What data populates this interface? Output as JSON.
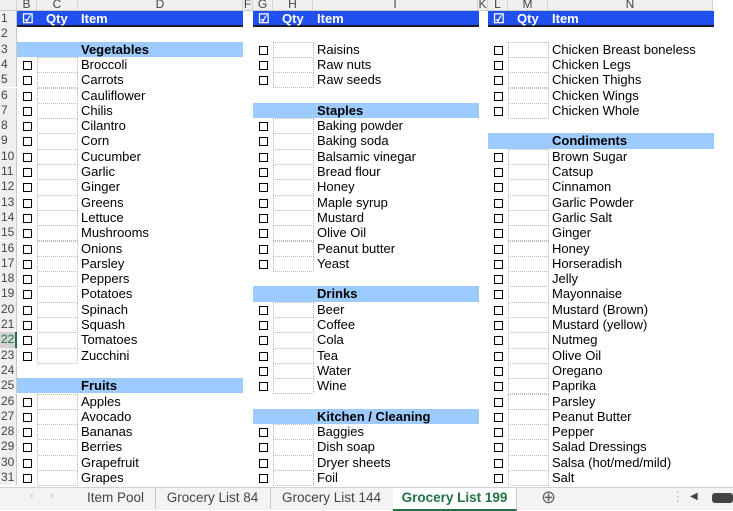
{
  "column_headers": [
    {
      "label": "B",
      "l": 17,
      "w": 20
    },
    {
      "label": "C",
      "l": 37,
      "w": 41
    },
    {
      "label": "D",
      "l": 78,
      "w": 165
    },
    {
      "label": "F",
      "l": 243,
      "w": 10
    },
    {
      "label": "G",
      "l": 253,
      "w": 20
    },
    {
      "label": "H",
      "l": 273,
      "w": 40
    },
    {
      "label": "I",
      "l": 313,
      "w": 165
    },
    {
      "label": "K",
      "l": 478,
      "w": 10
    },
    {
      "label": "L",
      "l": 488,
      "w": 20
    },
    {
      "label": "M",
      "l": 508,
      "w": 40
    },
    {
      "label": "N",
      "l": 548,
      "w": 165
    }
  ],
  "selected_row": 22,
  "header": {
    "check": "☑",
    "qty": "Qty",
    "item": "Item"
  },
  "lists": [
    {
      "rows": {
        "3": {
          "cat": "Vegetables"
        },
        "4": "Broccoli",
        "5": "Carrots",
        "6": "Cauliflower",
        "7": "Chilis",
        "8": "Cilantro",
        "9": "Corn",
        "10": "Cucumber",
        "11": "Garlic",
        "12": "Ginger",
        "13": "Greens",
        "14": "Lettuce",
        "15": "Mushrooms",
        "16": "Onions",
        "17": "Parsley",
        "18": "Peppers",
        "19": "Potatoes",
        "20": "Spinach",
        "21": "Squash",
        "22": "Tomatoes",
        "23": "Zucchini",
        "25": {
          "cat": "Fruits"
        },
        "26": "Apples",
        "27": "Avocado",
        "28": "Bananas",
        "29": "Berries",
        "30": "Grapefruit",
        "31": "Grapes"
      }
    },
    {
      "rows": {
        "3": "Raisins",
        "4": "Raw nuts",
        "5": "Raw seeds",
        "7": {
          "cat": "Staples"
        },
        "8": "Baking powder",
        "9": "Baking soda",
        "10": "Balsamic vinegar",
        "11": "Bread flour",
        "12": "Honey",
        "13": "Maple syrup",
        "14": "Mustard",
        "15": "Olive Oil",
        "16": "Peanut butter",
        "17": "Yeast",
        "19": {
          "cat": "Drinks"
        },
        "20": "Beer",
        "21": "Coffee",
        "22": "Cola",
        "23": "Tea",
        "24": "Water",
        "25": "Wine",
        "27": {
          "cat": "Kitchen / Cleaning"
        },
        "28": "Baggies",
        "29": "Dish soap",
        "30": "Dryer sheets",
        "31": "Foil"
      }
    },
    {
      "rows": {
        "3": "Chicken Breast boneless",
        "4": "Chicken Legs",
        "5": "Chicken Thighs",
        "6": "Chicken Wings",
        "7": "Chicken Whole",
        "9": {
          "cat": "Condiments"
        },
        "10": "Brown Sugar",
        "11": "Catsup",
        "12": "Cinnamon",
        "13": "Garlic Powder",
        "14": "Garlic Salt",
        "15": "Ginger",
        "16": "Honey",
        "17": "Horseradish",
        "18": "Jelly",
        "19": "Mayonnaise",
        "20": "Mustard (Brown)",
        "21": "Mustard (yellow)",
        "22": "Nutmeg",
        "23": "Olive Oil",
        "24": "Oregano",
        "25": "Paprika",
        "26": "Parsley",
        "27": "Peanut Butter",
        "28": "Pepper",
        "29": "Salad Dressings",
        "30": "Salsa (hot/med/mild)",
        "31": "Salt"
      }
    }
  ],
  "sheet_tabs": [
    {
      "label": "Item Pool",
      "active": false
    },
    {
      "label": "Grocery List 84",
      "active": false
    },
    {
      "label": "Grocery List 144",
      "active": false
    },
    {
      "label": "Grocery List 199",
      "active": true
    }
  ],
  "add_sheet_icon": "⊕",
  "colors": {
    "header_bar": "#2050f0",
    "category": "#9ecbff",
    "active_tab": "#217346"
  }
}
